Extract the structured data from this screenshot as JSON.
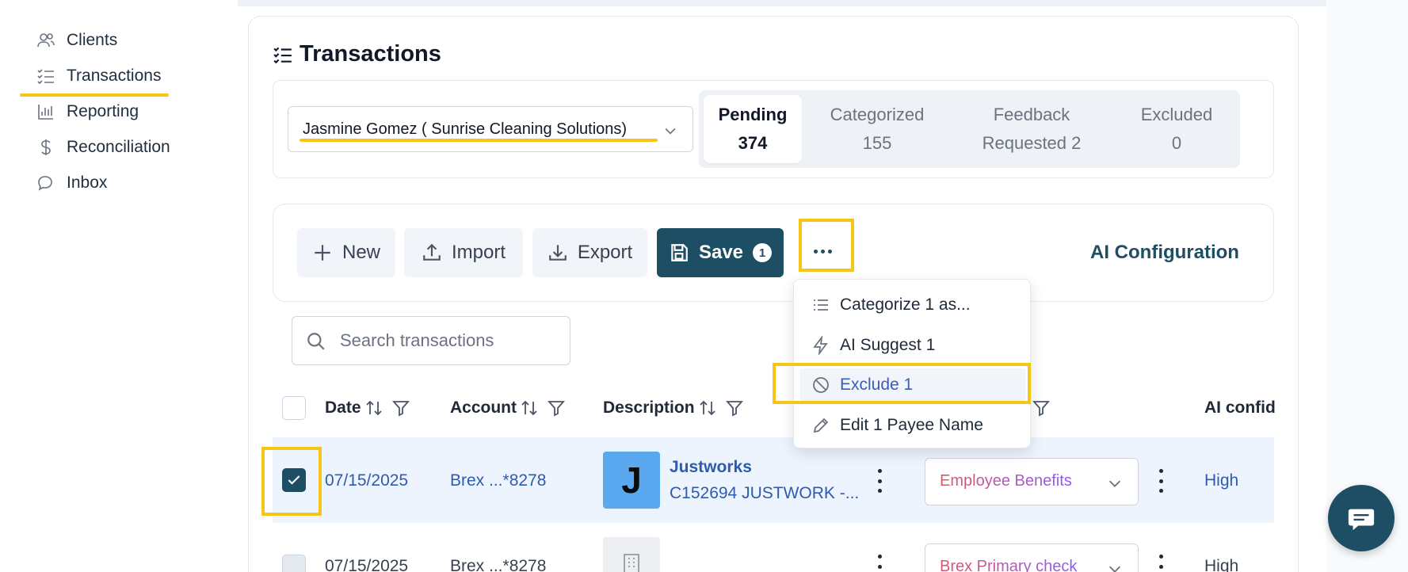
{
  "sidebar": {
    "items": [
      {
        "label": "Clients",
        "icon": "users-icon"
      },
      {
        "label": "Transactions",
        "icon": "list-check-icon"
      },
      {
        "label": "Reporting",
        "icon": "bar-chart-icon"
      },
      {
        "label": "Reconciliation",
        "icon": "dollar-icon"
      },
      {
        "label": "Inbox",
        "icon": "chat-bubbles-icon"
      }
    ],
    "active": "Transactions"
  },
  "page": {
    "title": "Transactions"
  },
  "client_select": {
    "value": "Jasmine Gomez ( Sunrise Cleaning Solutions)"
  },
  "status_tabs": [
    {
      "label": "Pending",
      "count": "374",
      "active": true
    },
    {
      "label": "Categorized",
      "count": "155"
    },
    {
      "label": "Feedback",
      "label2": "Requested 2"
    },
    {
      "label": "Excluded",
      "count": "0"
    }
  ],
  "toolbar": {
    "new_label": "New",
    "import_label": "Import",
    "export_label": "Export",
    "save_label": "Save",
    "save_badge": "1",
    "ai_config_label": "AI Configuration"
  },
  "menu": {
    "items": [
      {
        "label": "Categorize 1 as...",
        "icon": "list-icon"
      },
      {
        "label": "AI Suggest 1",
        "icon": "lightning-icon"
      },
      {
        "label": "Exclude 1",
        "icon": "ban-icon",
        "highlighted": true
      },
      {
        "label": "Edit 1 Payee Name",
        "icon": "pencil-icon"
      }
    ]
  },
  "search": {
    "placeholder": "Search transactions",
    "value": ""
  },
  "table": {
    "headers": {
      "date": "Date",
      "account": "Account",
      "description": "Description",
      "ai_confidence": "AI confid"
    },
    "rows": [
      {
        "checked": true,
        "date": "07/15/2025",
        "account": "Brex ...*8278",
        "logo_letter": "J",
        "payee": "Justworks",
        "description": "C152694 JUSTWORK -...",
        "category": "Employee Benefits",
        "ai_confidence": "High"
      },
      {
        "checked": false,
        "date": "07/15/2025",
        "account": "Brex ...*8278",
        "payee": "",
        "description": "",
        "category": "Brex Primary check",
        "ai_confidence": "High"
      }
    ]
  },
  "colors": {
    "accent": "#1d4e63",
    "link": "#2d5bb0",
    "highlight": "#f5c518",
    "row_selected": "#edf4fd"
  }
}
